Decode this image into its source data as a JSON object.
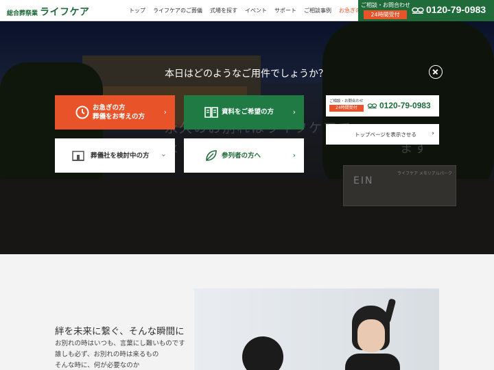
{
  "header": {
    "logo_sub": "総合葬祭業",
    "logo_main": "ライフケア",
    "nav": [
      "トップ",
      "ライフケアのご葬儀",
      "式場を探す",
      "イベント",
      "サポート",
      "ご相談事例",
      "お急ぎの方へ"
    ],
    "contact_label": "ご相談・お問合わせ",
    "contact_badge": "24時間受付",
    "freedial_icon": "freedial-icon",
    "phone": "0120-79-0983"
  },
  "hero": {
    "tagline": "永久のお別れはライフケアで",
    "tagline2": "永                                        ます",
    "sign_ein": "EIN",
    "sign_name": "ライフケア メモリアルパーク"
  },
  "modal": {
    "question": "本日はどのようなご用件でしょうか？",
    "close_icon": "close-icon",
    "options": [
      {
        "line1": "お急ぎの方",
        "line2": "葬儀をお考えの方",
        "icon": "clock-icon",
        "color": "#e8532a"
      },
      {
        "line1": "資料をご希望の方",
        "icon": "book-icon",
        "color": "#1f7a44"
      },
      {
        "line1": "葬儀社を検討中の方",
        "icon": "building-icon",
        "color": "#ffffff"
      },
      {
        "line1": "参列者の方へ",
        "icon": "leaf-icon",
        "color": "#ffffff"
      }
    ],
    "contact_label": "ご相談・お問合わせ",
    "contact_badge": "24時間受付",
    "phone": "0120-79-0983",
    "top_button": "トップページを表示させる"
  },
  "lower": {
    "heading": "絆を未来に繋ぐ、そんな瞬間に",
    "lines": [
      "お別れの時はいつも、言葉にし難いものです",
      "誰しも必ず、お別れの時は来るもの",
      "そんな時に、何が必要なのか"
    ]
  },
  "colors": {
    "brand_green": "#1f6b3a",
    "urgent_orange": "#e8532a"
  }
}
